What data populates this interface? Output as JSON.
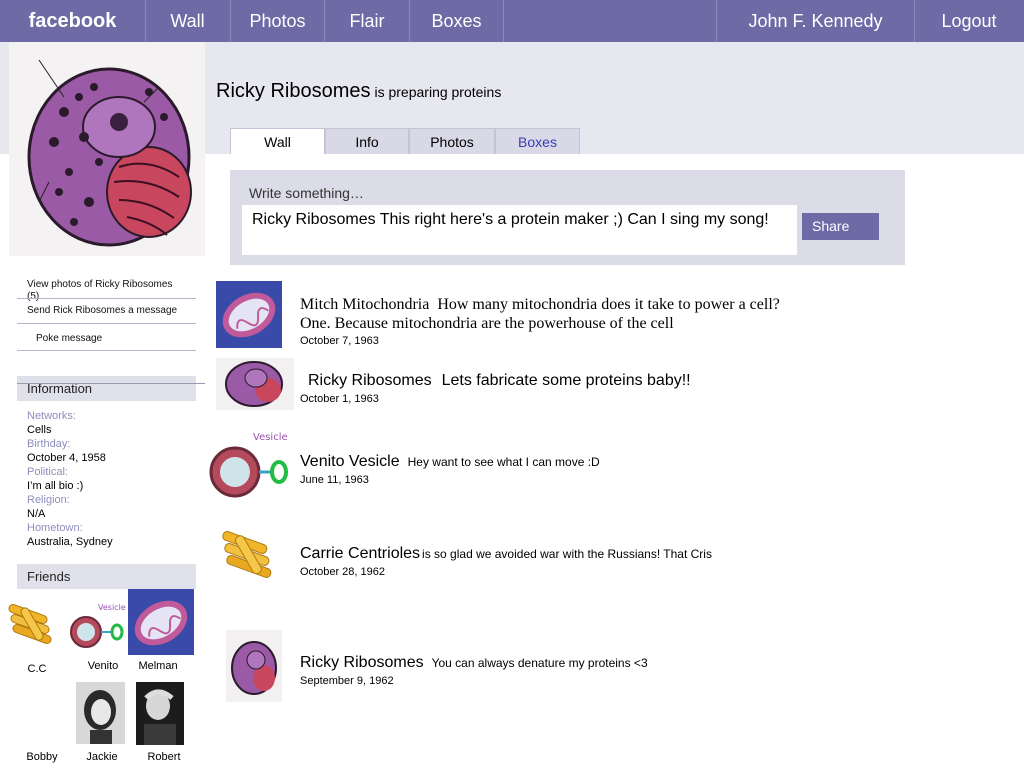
{
  "topbar": {
    "logo": "facebook",
    "nav": [
      "Wall",
      "Photos",
      "Flair",
      "Boxes"
    ],
    "user": "John F. Kennedy",
    "logout": "Logout",
    "color": "#6d6aa6"
  },
  "profile": {
    "name": "Ricky Ribosomes",
    "status": "is preparing proteins",
    "tabs": [
      "Wall",
      "Info",
      "Photos",
      "Boxes"
    ]
  },
  "composer": {
    "label": "Write something…",
    "text": "Ricky Ribosomes This right here's a protein maker ;) Can I sing my song!",
    "share": "Share"
  },
  "sidebar": {
    "links": [
      "View photos of Ricky Ribosomes (5)",
      "Send Rick Ribosomes a message",
      "Poke message"
    ],
    "information_title": "Information",
    "info": [
      {
        "label": "Networks:",
        "value": "Cells"
      },
      {
        "label": "Birthday:",
        "value": "October 4, 1958"
      },
      {
        "label": "Political:",
        "value": "I’m all bio :)"
      },
      {
        "label": "Religion:",
        "value": "N/A"
      },
      {
        "label": "Hometown:",
        "value": "Australia, Sydney"
      }
    ],
    "friends_title": "Friends",
    "friends": [
      "C.C",
      "Venito",
      "Melman",
      "Bobby",
      "Jackie",
      "Robert"
    ]
  },
  "posts": [
    {
      "author": "Mitch Mitochondria",
      "message": "How many mitochondria does it take to power a cell? One. Because mitochondria are the powerhouse of the cell",
      "date": "October 7, 1963"
    },
    {
      "author": "Ricky Ribosomes",
      "message": "Lets fabricate some proteins baby!!",
      "date": "October 1, 1963"
    },
    {
      "author": "Venito Vesicle",
      "message": "Hey want to see what I can move :D",
      "date": "June 11, 1963"
    },
    {
      "author": "Carrie Centrioles",
      "message": "is so glad we avoided war with the Russians!  That Cris",
      "date": "October 28, 1962"
    },
    {
      "author": "Ricky Ribosomes",
      "message": "You can always denature my proteins <3",
      "date": "September 9, 1962"
    }
  ]
}
